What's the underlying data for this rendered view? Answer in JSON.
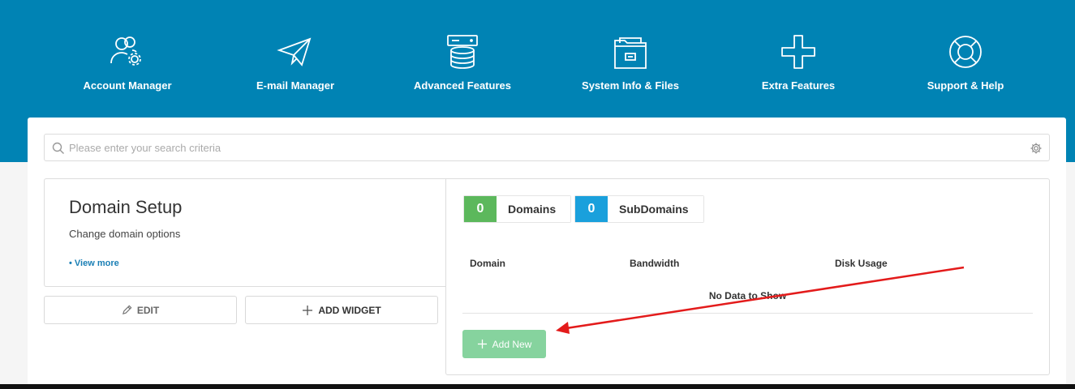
{
  "nav": {
    "items": [
      {
        "label": "Account Manager",
        "icon": "users-gear-icon"
      },
      {
        "label": "E-mail Manager",
        "icon": "paper-plane-icon"
      },
      {
        "label": "Advanced Features",
        "icon": "database-server-icon"
      },
      {
        "label": "System Info & Files",
        "icon": "folder-icon"
      },
      {
        "label": "Extra Features",
        "icon": "plus-icon"
      },
      {
        "label": "Support & Help",
        "icon": "lifebuoy-icon"
      }
    ]
  },
  "search": {
    "placeholder": "Please enter your search criteria"
  },
  "widget": {
    "title": "Domain Setup",
    "description": "Change domain options",
    "view_more": "• View more"
  },
  "buttons": {
    "edit": "EDIT",
    "add_widget": "ADD WIDGET",
    "add_new": "Add New"
  },
  "stats": {
    "domains": {
      "count": "0",
      "label": "Domains"
    },
    "subdomains": {
      "count": "0",
      "label": "SubDomains"
    }
  },
  "table": {
    "columns": [
      "Domain",
      "Bandwidth",
      "Disk Usage"
    ],
    "empty_text": "No Data to Show"
  },
  "colors": {
    "header": "#0083b4",
    "green": "#5cb85c",
    "blue": "#1aa0dc",
    "add_button": "#86d39e",
    "annotation": "#e31b1b"
  }
}
